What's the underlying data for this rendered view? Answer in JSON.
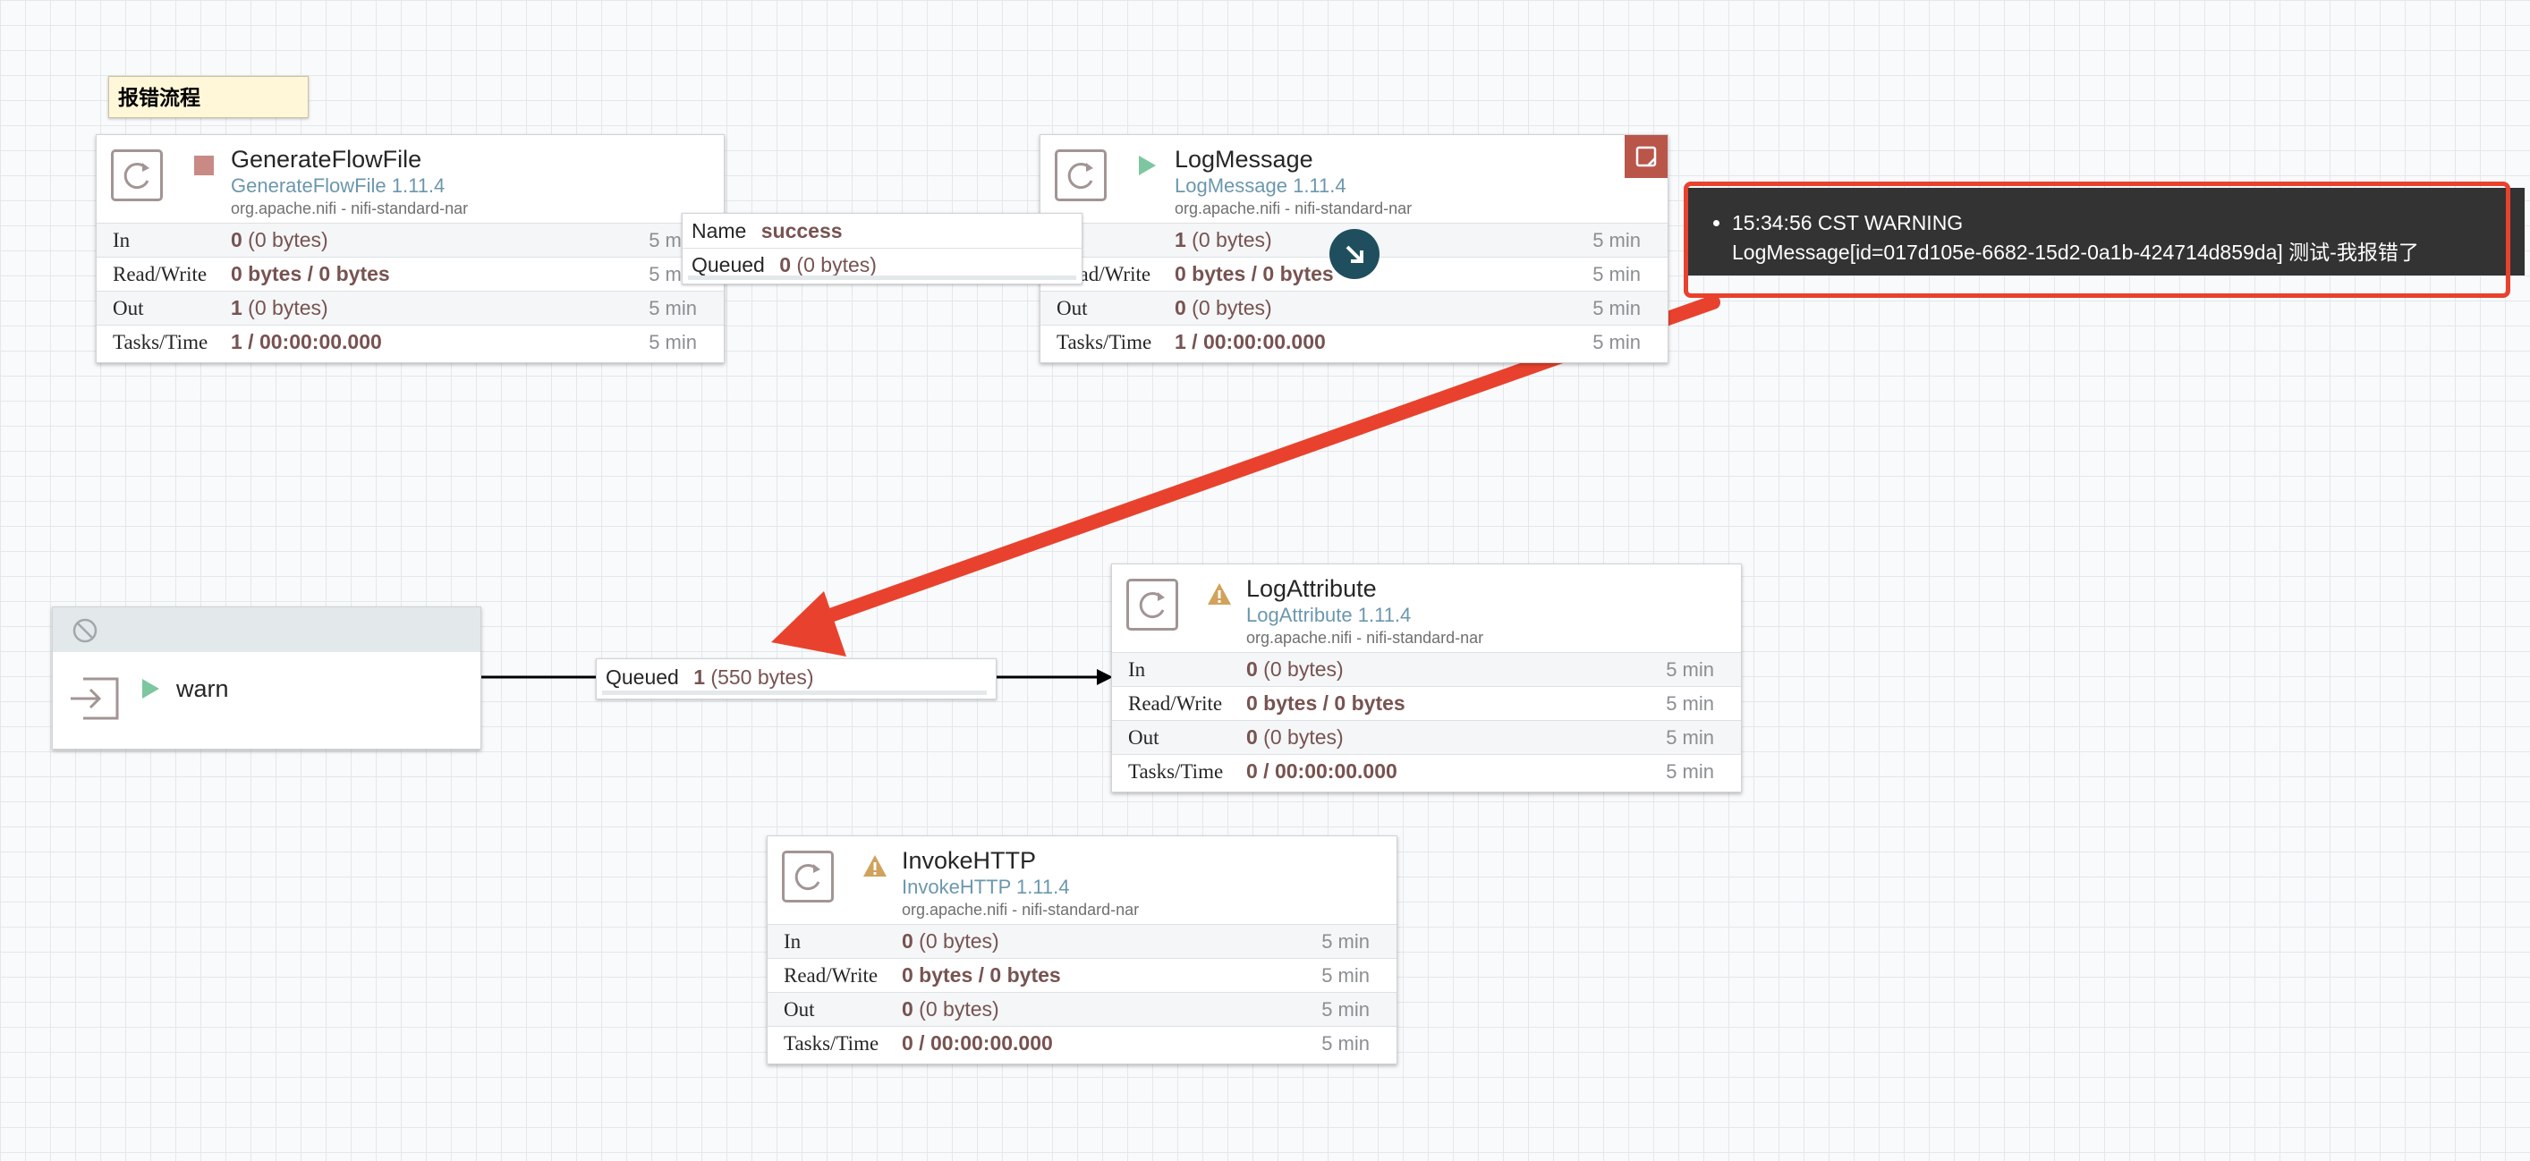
{
  "label": {
    "text": "报错流程"
  },
  "colors": {
    "accent_red": "#e8422e",
    "value_text": "#775351",
    "type_text": "#6b97ad",
    "canvas_bg": "#f9fafb"
  },
  "processors": {
    "generate": {
      "name": "GenerateFlowFile",
      "type": "GenerateFlowFile 1.11.4",
      "bundle": "org.apache.nifi - nifi-standard-nar",
      "state": "stopped",
      "stats": [
        {
          "key": "In",
          "strong": "0",
          "rest": " (0 bytes)",
          "time": "5 min"
        },
        {
          "key": "Read/Write",
          "strong": "0 bytes / 0 bytes",
          "rest": "",
          "time": "5 min"
        },
        {
          "key": "Out",
          "strong": "1",
          "rest": " (0 bytes)",
          "time": "5 min"
        },
        {
          "key": "Tasks/Time",
          "strong": "1 / 00:00:00.000",
          "rest": "",
          "time": "5 min"
        }
      ]
    },
    "logmessage": {
      "name": "LogMessage",
      "type": "LogMessage 1.11.4",
      "bundle": "org.apache.nifi - nifi-standard-nar",
      "state": "running",
      "stats": [
        {
          "key": "In",
          "strong": "1",
          "rest": " (0 bytes)",
          "time": "5 min"
        },
        {
          "key": "Read/Write",
          "strong": "0 bytes / 0 bytes",
          "rest": "",
          "time": "5 min"
        },
        {
          "key": "Out",
          "strong": "0",
          "rest": " (0 bytes)",
          "time": "5 min"
        },
        {
          "key": "Tasks/Time",
          "strong": "1 / 00:00:00.000",
          "rest": "",
          "time": "5 min"
        }
      ]
    },
    "logattribute": {
      "name": "LogAttribute",
      "type": "LogAttribute 1.11.4",
      "bundle": "org.apache.nifi - nifi-standard-nar",
      "state": "invalid",
      "stats": [
        {
          "key": "In",
          "strong": "0",
          "rest": " (0 bytes)",
          "time": "5 min"
        },
        {
          "key": "Read/Write",
          "strong": "0 bytes / 0 bytes",
          "rest": "",
          "time": "5 min"
        },
        {
          "key": "Out",
          "strong": "0",
          "rest": " (0 bytes)",
          "time": "5 min"
        },
        {
          "key": "Tasks/Time",
          "strong": "0 / 00:00:00.000",
          "rest": "",
          "time": "5 min"
        }
      ]
    },
    "invokehttp": {
      "name": "InvokeHTTP",
      "type": "InvokeHTTP 1.11.4",
      "bundle": "org.apache.nifi - nifi-standard-nar",
      "state": "invalid",
      "stats": [
        {
          "key": "In",
          "strong": "0",
          "rest": " (0 bytes)",
          "time": "5 min"
        },
        {
          "key": "Read/Write",
          "strong": "0 bytes / 0 bytes",
          "rest": "",
          "time": "5 min"
        },
        {
          "key": "Out",
          "strong": "0",
          "rest": " (0 bytes)",
          "time": "5 min"
        },
        {
          "key": "Tasks/Time",
          "strong": "0 / 00:00:00.000",
          "rest": "",
          "time": "5 min"
        }
      ]
    }
  },
  "connection_success": {
    "name_key": "Name",
    "name_value": "success",
    "queued_key": "Queued",
    "queued_count": "0",
    "queued_size": " (0 bytes)"
  },
  "connection_warn": {
    "queued_key": "Queued",
    "queued_count": "1",
    "queued_size": " (550 bytes)"
  },
  "port": {
    "name": "warn",
    "state": "running"
  },
  "bulletin": {
    "time_level": "15:34:56 CST  WARNING",
    "message": "LogMessage[id=017d105e-6682-15d2-0a1b-424714d859da] 测试-我报错了"
  }
}
